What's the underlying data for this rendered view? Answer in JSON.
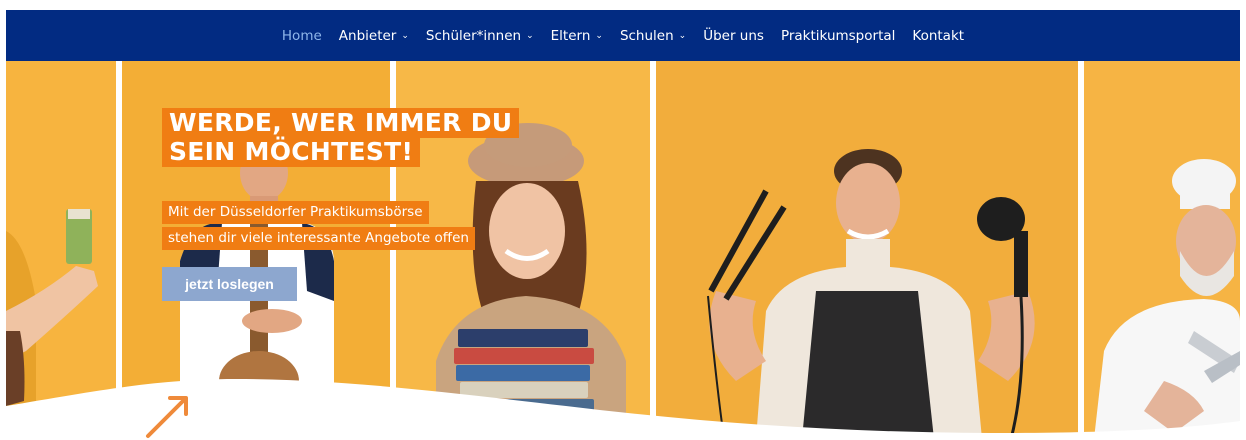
{
  "nav": {
    "items": [
      {
        "label": "Home",
        "active": true,
        "dropdown": false
      },
      {
        "label": "Anbieter",
        "active": false,
        "dropdown": true
      },
      {
        "label": "Schüler*innen",
        "active": false,
        "dropdown": true
      },
      {
        "label": "Eltern",
        "active": false,
        "dropdown": true
      },
      {
        "label": "Schulen",
        "active": false,
        "dropdown": true
      },
      {
        "label": "Über uns",
        "active": false,
        "dropdown": false
      },
      {
        "label": "Praktikumsportal",
        "active": false,
        "dropdown": false
      },
      {
        "label": "Kontakt",
        "active": false,
        "dropdown": false
      }
    ],
    "chevron": "⌄"
  },
  "hero": {
    "headline_line1": "WERDE, WER IMMER DU",
    "headline_line2": "SEIN MÖCHTEST!",
    "sub_line1": "Mit der Düsseldorfer Praktikumsbörse",
    "sub_line2": "stehen dir viele interessante Angebote offen",
    "cta_label": "jetzt loslegen"
  },
  "colors": {
    "nav_bg": "#022b82",
    "nav_active": "#8fb6ea",
    "hero_orange": "#f6b23c",
    "label_orange": "#f07d13",
    "cta_bg": "#8da7cf",
    "arrow": "#ef8a3a"
  },
  "icons": {
    "chevron": "chevron-down-icon",
    "arrow": "arrow-up-right-icon"
  }
}
